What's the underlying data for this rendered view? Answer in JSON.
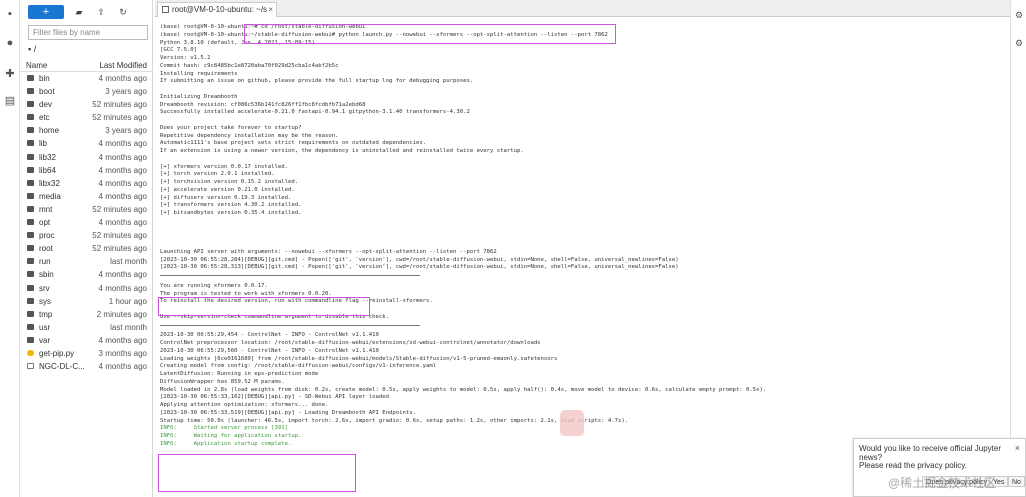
{
  "activity": {
    "icons": [
      "folder-icon",
      "running-icon",
      "extension-icon",
      "tree-icon"
    ]
  },
  "filebrowser": {
    "new_label": "+",
    "filter_placeholder": "Filter files by name",
    "breadcrumb": "/",
    "col_name": "Name",
    "col_modified": "Last Modified",
    "rows": [
      {
        "name": "bin",
        "modified": "4 months ago",
        "kind": "folder"
      },
      {
        "name": "boot",
        "modified": "3 years ago",
        "kind": "folder"
      },
      {
        "name": "dev",
        "modified": "52 minutes ago",
        "kind": "folder"
      },
      {
        "name": "etc",
        "modified": "52 minutes ago",
        "kind": "folder"
      },
      {
        "name": "home",
        "modified": "3 years ago",
        "kind": "folder"
      },
      {
        "name": "lib",
        "modified": "4 months ago",
        "kind": "folder"
      },
      {
        "name": "lib32",
        "modified": "4 months ago",
        "kind": "folder"
      },
      {
        "name": "lib64",
        "modified": "4 months ago",
        "kind": "folder"
      },
      {
        "name": "libx32",
        "modified": "4 months ago",
        "kind": "folder"
      },
      {
        "name": "media",
        "modified": "4 months ago",
        "kind": "folder"
      },
      {
        "name": "mnt",
        "modified": "52 minutes ago",
        "kind": "folder"
      },
      {
        "name": "opt",
        "modified": "4 months ago",
        "kind": "folder"
      },
      {
        "name": "proc",
        "modified": "52 minutes ago",
        "kind": "folder"
      },
      {
        "name": "root",
        "modified": "52 minutes ago",
        "kind": "folder"
      },
      {
        "name": "run",
        "modified": "last month",
        "kind": "folder"
      },
      {
        "name": "sbin",
        "modified": "4 months ago",
        "kind": "folder"
      },
      {
        "name": "srv",
        "modified": "4 months ago",
        "kind": "folder"
      },
      {
        "name": "sys",
        "modified": "1 hour ago",
        "kind": "folder"
      },
      {
        "name": "tmp",
        "modified": "2 minutes ago",
        "kind": "folder"
      },
      {
        "name": "usr",
        "modified": "last month",
        "kind": "folder"
      },
      {
        "name": "var",
        "modified": "4 months ago",
        "kind": "folder"
      },
      {
        "name": "get-pip.py",
        "modified": "3 months ago",
        "kind": "py"
      },
      {
        "name": "NGC-DL-C...",
        "modified": "4 months ago",
        "kind": "file"
      }
    ]
  },
  "tab": {
    "label": "root@VM-0-10-ubuntu: ~/s",
    "close": "×"
  },
  "terminal": {
    "lines": [
      {
        "t": "(base) root@VM-0-10-ubuntu:~# cd /root/stable-diffusion-webui"
      },
      {
        "t": "(base) root@VM-0-10-ubuntu:~/stable-diffusion-webui# python launch.py --nowebui --xformers --opt-split-attention --listen --port 7862"
      },
      {
        "t": "Python 3.8.10 (default, Jun  4 2021, 15:09:15)"
      },
      {
        "t": "[GCC 7.5.0]"
      },
      {
        "t": "Version: v1.5.2"
      },
      {
        "t": "Commit hash: c9c8485bc1e8720aba70f029d25cba1c4abf2b5c"
      },
      {
        "t": "Installing requirements"
      },
      {
        "t": "If submitting an issue on github, please provide the full startup log for debugging purposes."
      },
      {
        "t": ""
      },
      {
        "t": "Initializing Dreambooth"
      },
      {
        "t": "Dreambooth revision: cf086c536b141fc826ff1fbc8fcdbfb71a2ebd68"
      },
      {
        "t": "Successfully installed accelerate-0.21.0 fastapi-0.94.1 gitpython-3.1.40 transformers-4.30.2"
      },
      {
        "t": ""
      },
      {
        "t": "Does your project take forever to startup?"
      },
      {
        "t": "Repetitive dependency installation may be the reason."
      },
      {
        "t": "Automatic1111's base project sets strict requirements on outdated dependencies."
      },
      {
        "t": "If an extension is using a newer version, the dependency is uninstalled and reinstalled twice every startup."
      },
      {
        "t": ""
      },
      {
        "t": "[+] xformers version 0.0.17 installed."
      },
      {
        "t": "[+] torch version 2.0.1 installed."
      },
      {
        "t": "[+] torchvision version 0.15.2 installed."
      },
      {
        "t": "[+] accelerate version 0.21.0 installed."
      },
      {
        "t": "[+] diffusers version 0.19.3 installed."
      },
      {
        "t": "[+] transformers version 4.30.2 installed."
      },
      {
        "t": "[+] bitsandbytes version 0.35.4 installed."
      },
      {
        "t": ""
      },
      {
        "t": ""
      },
      {
        "t": ""
      },
      {
        "t": ""
      },
      {
        "t": "Launching API server with arguments: --nowebui --xformers --opt-split-attention --listen --port 7862"
      },
      {
        "t": "[2023-10-30 06:55:28,284][DEBUG][git.cmd] - Popen(['git', 'version'], cwd=/root/stable-diffusion-webui, stdin=None, shell=False, universal_newlines=False)"
      },
      {
        "t": "[2023-10-30 06:55:28,313][DEBUG][git.cmd] - Popen(['git', 'version'], cwd=/root/stable-diffusion-webui, stdin=None, shell=False, universal_newlines=False)"
      },
      {
        "t": "",
        "rule": true
      },
      {
        "t": "You are running xformers 0.0.17."
      },
      {
        "t": "The program is tested to work with xformers 0.0.20."
      },
      {
        "t": "To reinstall the desired version, run with commandline flag --reinstall-xformers."
      },
      {
        "t": ""
      },
      {
        "t": "Use --skip-version-check commandline argument to disable this check."
      },
      {
        "t": "",
        "rule": true
      },
      {
        "t": "2023-10-30 06:55:29,454 - ControlNet - INFO - ControlNet v1.1.410"
      },
      {
        "t": "ControlNet preprocessor location: /root/stable-diffusion-webui/extensions/sd-webui-controlnet/annotator/downloads"
      },
      {
        "t": "2023-10-30 06:55:29,560 - ControlNet - INFO - ControlNet v1.1.410"
      },
      {
        "t": "Loading weights [6ce0161689] from /root/stable-diffusion-webui/models/Stable-diffusion/v1-5-pruned-emaonly.safetensors"
      },
      {
        "t": "Creating model from config: /root/stable-diffusion-webui/configs/v1-inference.yaml"
      },
      {
        "t": "LatentDiffusion: Running in eps-prediction mode"
      },
      {
        "t": "DiffusionWrapper has 859.52 M params."
      },
      {
        "t": "Model loaded in 2.8s (load weights from disk: 0.2s, create model: 0.5s, apply weights to model: 0.5s, apply half(): 0.4s, move model to device: 0.6s, calculate empty prompt: 0.5s)."
      },
      {
        "t": "[2023-10-30 06:55:33,162][DEBUG][api.py] - SD-Webui API layer loaded"
      },
      {
        "t": "Applying attention optimization: xformers... done."
      },
      {
        "t": "[2023-10-30 06:55:33,519][DEBUG][api.py] - Loading Dreambooth API Endpoints."
      },
      {
        "t": "Startup time: 50.0s (launcher: 46.5s, import torch: 2.6s, import gradio: 0.6s, setup paths: 1.2s, other imports: 2.1s, load scripts: 4.7s)."
      },
      {
        "t": "INFO:     Started server process [391]",
        "cls": "info"
      },
      {
        "t": "INFO:     Waiting for application startup.",
        "cls": "info"
      },
      {
        "t": "INFO:     Application startup complete.",
        "cls": "info"
      }
    ]
  },
  "popup": {
    "question": "Would you like to receive official Jupyter news?",
    "privacy": "Please read the privacy policy.",
    "close": "×",
    "open_policy": "Open privacy policy",
    "yes": "Yes",
    "no": "No"
  },
  "watermark": "@稀土掘金技术社区",
  "colors": {
    "accent": "#1976d2",
    "highlight": "#d050e0",
    "info": "#3a9a3a"
  }
}
